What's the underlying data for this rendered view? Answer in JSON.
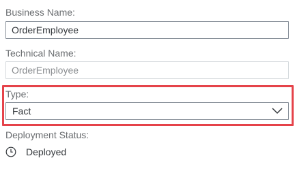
{
  "business_name": {
    "label": "Business Name:",
    "value": "OrderEmployee"
  },
  "technical_name": {
    "label": "Technical Name:",
    "value": "OrderEmployee"
  },
  "type": {
    "label": "Type:",
    "value": "Fact"
  },
  "deployment_status": {
    "label": "Deployment Status:",
    "value": "Deployed",
    "icon": "clock-icon"
  },
  "colors": {
    "highlight": "#e5434a",
    "label": "#6a6d70",
    "text": "#32363a",
    "readonly_text": "#8a8d90"
  }
}
